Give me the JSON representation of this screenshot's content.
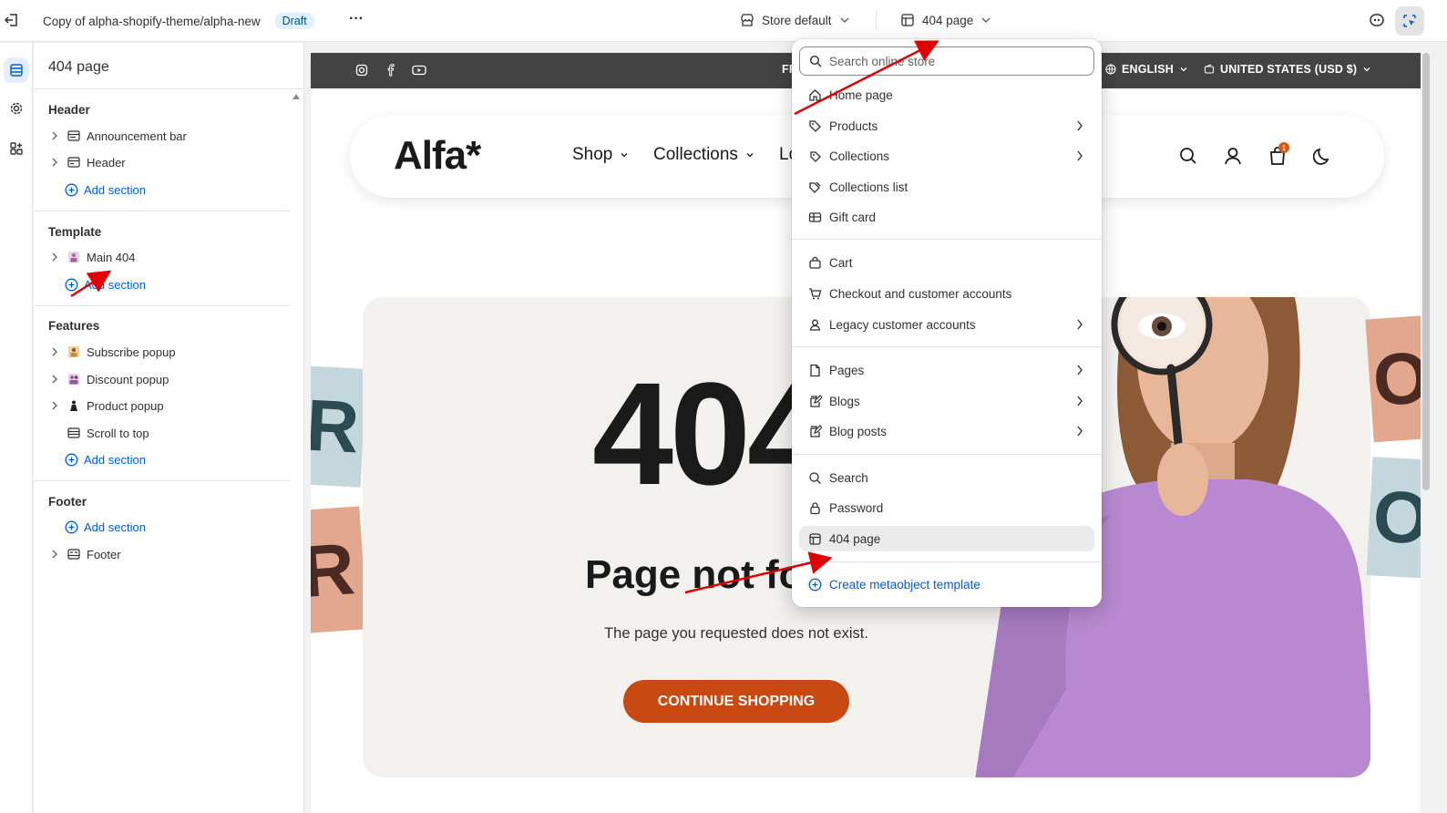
{
  "topbar": {
    "theme_name": "Copy of alpha-shopify-theme/alpha-new",
    "status_badge": "Draft",
    "more_label": "···",
    "store_selector": "Store default",
    "template_selector": "404 page"
  },
  "sidebar": {
    "title": "404 page",
    "groups": {
      "header": {
        "title": "Header",
        "items": [
          "Announcement bar",
          "Header"
        ],
        "add": "Add section"
      },
      "template": {
        "title": "Template",
        "items": [
          "Main 404"
        ],
        "add": "Add section"
      },
      "features": {
        "title": "Features",
        "items": [
          "Subscribe popup",
          "Discount popup",
          "Product popup",
          "Scroll to top"
        ],
        "add": "Add section"
      },
      "footer": {
        "title": "Footer",
        "add": "Add section",
        "items": [
          "Footer"
        ]
      }
    }
  },
  "preview": {
    "announcement": {
      "partial_text": "FR",
      "language": "ENGLISH",
      "currency": "UNITED STATES (USD $)"
    },
    "header": {
      "logo": "Alfa*",
      "nav": [
        "Shop",
        "Collections",
        "Lo"
      ],
      "cart_count": "1"
    },
    "error": {
      "code": "404",
      "heading": "Page not fo",
      "message": "The page you requested does not exist.",
      "cta": "CONTINUE SHOPPING"
    },
    "tiles": [
      "R",
      "R",
      "OR",
      "OR"
    ]
  },
  "dropdown": {
    "search_placeholder": "Search online store",
    "items": [
      {
        "label": "Home page",
        "has_sub": false
      },
      {
        "label": "Products",
        "has_sub": true
      },
      {
        "label": "Collections",
        "has_sub": true
      },
      {
        "label": "Collections list",
        "has_sub": false
      },
      {
        "label": "Gift card",
        "has_sub": false
      },
      {
        "label": "Cart",
        "has_sub": false
      },
      {
        "label": "Checkout and customer accounts",
        "has_sub": false
      },
      {
        "label": "Legacy customer accounts",
        "has_sub": true
      },
      {
        "label": "Pages",
        "has_sub": true
      },
      {
        "label": "Blogs",
        "has_sub": true
      },
      {
        "label": "Blog posts",
        "has_sub": true
      },
      {
        "label": "Search",
        "has_sub": false
      },
      {
        "label": "Password",
        "has_sub": false
      },
      {
        "label": "404 page",
        "has_sub": false,
        "selected": true
      }
    ],
    "create_label": "Create metaobject template"
  },
  "colors": {
    "accent_blue": "#005bd3",
    "cta_orange": "#c84a12",
    "announcement_bg": "#434343",
    "annotation_red": "#e00000"
  }
}
